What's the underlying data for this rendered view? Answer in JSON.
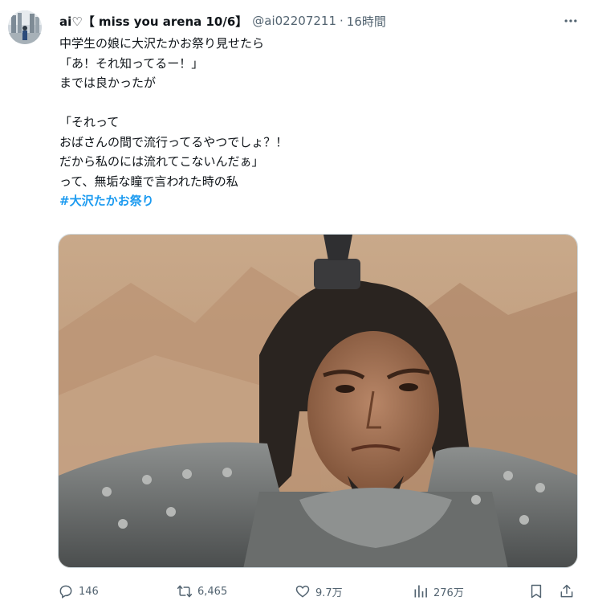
{
  "author": {
    "display_name": "ai♡【 miss you arena 10/6】",
    "handle": "@ai02207211",
    "separator": "·",
    "time": "16時間"
  },
  "tweet": {
    "lines": [
      "中学生の娘に大沢たかお祭り見せたら",
      "「あ！それ知ってるー！」",
      "までは良かったが",
      "",
      "「それって",
      "おばさんの間で流行ってるやつでしょ？！",
      "だから私のには流れてこないんだぁ」",
      "って、無垢な瞳で言われた時の私"
    ],
    "hashtag": "#大沢たかお祭り"
  },
  "actions": {
    "reply": {
      "icon": "reply-icon",
      "count": "146"
    },
    "retweet": {
      "icon": "retweet-icon",
      "count": "6,465"
    },
    "like": {
      "icon": "heart-icon",
      "count": "9.7万"
    },
    "views": {
      "icon": "bar-chart-icon",
      "count": "276万"
    },
    "bookmark": {
      "icon": "bookmark-icon"
    },
    "share": {
      "icon": "share-icon"
    }
  },
  "colors": {
    "text": "#0f1419",
    "secondary": "#536471",
    "link": "#1d9bf0",
    "border": "#cfd9de"
  }
}
